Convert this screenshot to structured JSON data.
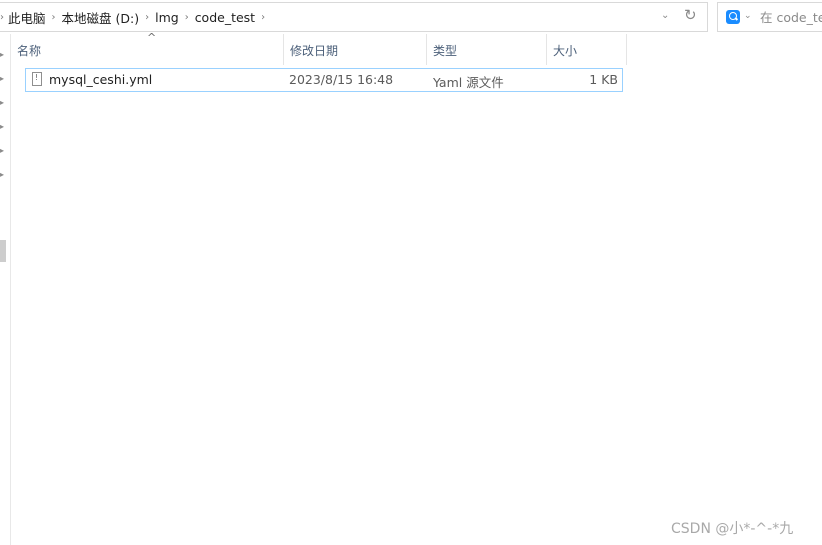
{
  "address_bar": {
    "breadcrumbs": [
      "此电脑",
      "本地磁盘 (D:)",
      "lmg",
      "code_test"
    ]
  },
  "search": {
    "placeholder": "在 code_te"
  },
  "columns": {
    "name": "名称",
    "date": "修改日期",
    "type": "类型",
    "size": "大小"
  },
  "files": [
    {
      "name": "mysql_ceshi.yml",
      "date": "2023/8/15 16:48",
      "type": "Yaml 源文件",
      "size": "1 KB"
    }
  ],
  "watermark": "CSDN @小*-^-*九",
  "colors": {
    "selection_border": "#99d1ff",
    "search_icon": "#1a8cff",
    "header_text": "#4c607a"
  }
}
